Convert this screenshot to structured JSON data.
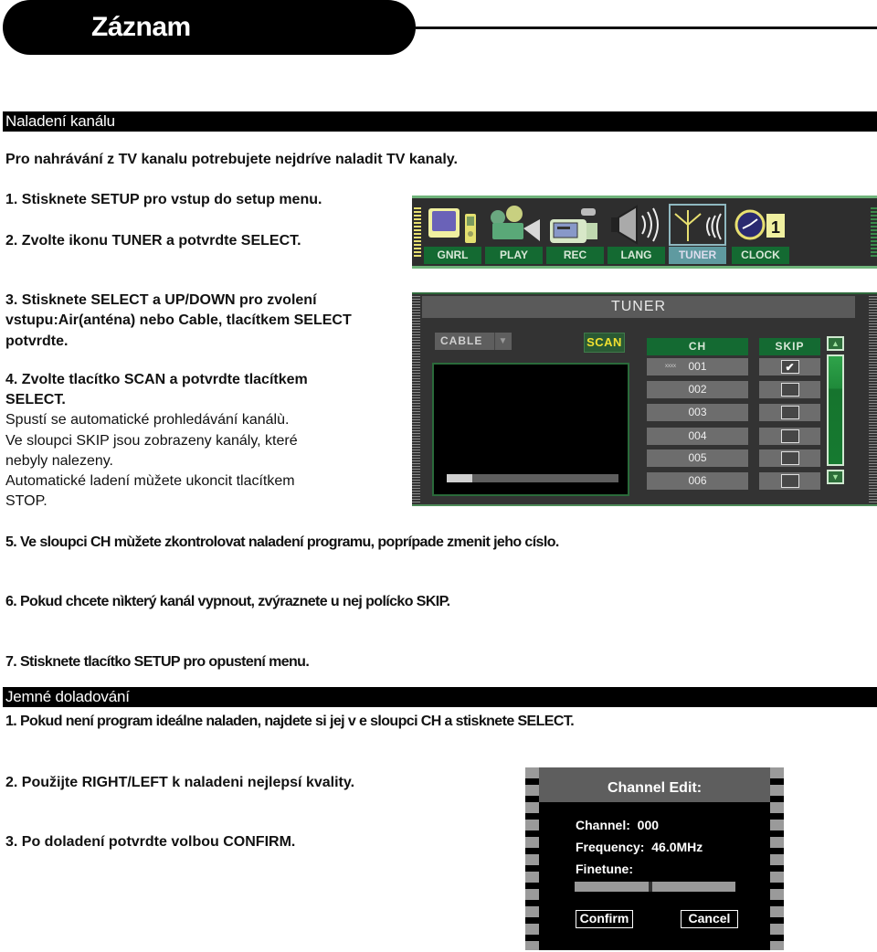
{
  "header": {
    "title": "Záznam"
  },
  "section1": {
    "heading": "Naladení kanálu",
    "intro": "Pro nahrávání z TV kanalu potrebujete nejdríve naladit TV kanaly.",
    "step1": "1. Stisknete SETUP pro vstup do setup menu.",
    "step2": "2. Zvolte ikonu TUNER a potvrdte SELECT.",
    "step3": [
      "3. Stisknete SELECT a UP/DOWN pro zvolení",
      "vstupu:Air(anténa) nebo Cable, tlacítkem SELECT",
      "potvrdte."
    ],
    "step4": [
      "4. Zvolte tlacítko SCAN a potvrdte tlacítkem",
      " SELECT."
    ],
    "step4_notes": [
      "Spustí se automatické prohledávání kanálù.",
      "Ve sloupci SKIP jsou zobrazeny kanály, které",
      "nebyly nalezeny.",
      "Automatické ladení mùžete ukoncit tlacítkem",
      "STOP."
    ],
    "step5": "5. Ve sloupci CH mùžete zkontrolovat naladení programu, poprípade zmenit jeho císlo.",
    "step6": "6. Pokud chcete nìkterý kanál vypnout, zvýraznete u nej polícko SKIP.",
    "step7": "7. Stisknete tlacítko SETUP pro opustení menu."
  },
  "setup_menu": {
    "items": [
      {
        "label": "GNRL",
        "icon": "tv-remote-icon"
      },
      {
        "label": "PLAY",
        "icon": "projector-icon"
      },
      {
        "label": "REC",
        "icon": "camcorder-icon"
      },
      {
        "label": "LANG",
        "icon": "speaker-icon"
      },
      {
        "label": "TUNER",
        "icon": "antenna-icon",
        "active": true
      },
      {
        "label": "CLOCK",
        "icon": "clock-calendar-icon",
        "calendar_day": "1"
      }
    ]
  },
  "tuner": {
    "title": "TUNER",
    "source": "CABLE",
    "scan_label": "SCAN",
    "ch_header": "CH",
    "skip_header": "SKIP",
    "scan_progress_percent": 15,
    "channels": [
      {
        "ch": "001",
        "skip": true,
        "marker": "xxxx"
      },
      {
        "ch": "002",
        "skip": false
      },
      {
        "ch": "003",
        "skip": false
      },
      {
        "ch": "004",
        "skip": false
      },
      {
        "ch": "005",
        "skip": false
      },
      {
        "ch": "006",
        "skip": false
      }
    ],
    "checkmark": "✔",
    "arrow_up": "▲",
    "arrow_down": "▼"
  },
  "section2": {
    "heading": "Jemné doladování",
    "step1": "1. Pokud není program ideálne naladen, najdete si jej v e sloupci CH a stisknete SELECT.",
    "step2": "2. Použijte RIGHT/LEFT k naladeni nejlepsí kvality.",
    "step3": "3. Po doladení potvrdte volbou CONFIRM."
  },
  "channel_edit": {
    "title": "Channel Edit:",
    "channel_label": "Channel:",
    "channel_value": "000",
    "frequency_label": "Frequency:",
    "frequency_value": "46.0MHz",
    "finetune_label": "Finetune:",
    "finetune_position_percent": 47,
    "confirm_label": "Confirm",
    "cancel_label": "Cancel"
  }
}
